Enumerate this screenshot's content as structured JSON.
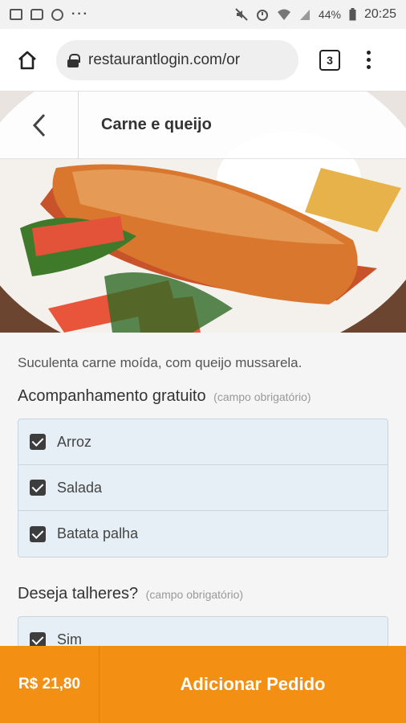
{
  "status_bar": {
    "battery": "44%",
    "time": "20:25",
    "icons": [
      "image-icon",
      "message-icon",
      "circle-icon",
      "more-notifications-icon",
      "mute-icon",
      "alarm-icon",
      "wifi-icon",
      "signal-icon",
      "battery-icon"
    ]
  },
  "browser": {
    "url": "restaurantlogin.com/or",
    "tab_count": "3"
  },
  "header": {
    "title": "Carne e queijo"
  },
  "product": {
    "description": "Suculenta carne moída, com queijo mussarela."
  },
  "sections": [
    {
      "title": "Acompanhamento gratuito",
      "required_note": "(campo obrigatório)",
      "options": [
        {
          "label": "Arroz",
          "checked": true
        },
        {
          "label": "Salada",
          "checked": true
        },
        {
          "label": "Batata palha",
          "checked": true
        }
      ]
    },
    {
      "title": "Deseja talheres?",
      "required_note": "(campo obrigatório)",
      "options": [
        {
          "label": "Sim",
          "checked": true
        }
      ]
    }
  ],
  "footer": {
    "price": "R$ 21,80",
    "add_label": "Adicionar Pedido"
  },
  "colors": {
    "accent": "#f39014",
    "option_bg": "#e6eff5"
  }
}
